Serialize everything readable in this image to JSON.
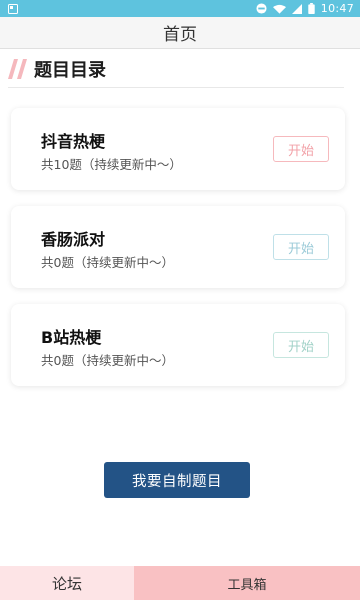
{
  "status_bar": {
    "time": "10:47",
    "left_icon": "notification-icon",
    "right_icons": [
      "dnd-icon",
      "wifi-icon",
      "signal-icon",
      "battery-icon"
    ]
  },
  "header": {
    "title": "首页"
  },
  "section": {
    "title": "题目目录"
  },
  "cards": [
    {
      "title": "抖音热梗",
      "subtitle": "共10题（持续更新中～）",
      "button": "开始"
    },
    {
      "title": "香肠派对",
      "subtitle": "共0题（持续更新中～）",
      "button": "开始"
    },
    {
      "title": "B站热梗",
      "subtitle": "共0题（持续更新中～）",
      "button": "开始"
    }
  ],
  "create_button": "我要自制题目",
  "bottom_nav": {
    "forum": "论坛",
    "tools": "工具箱"
  },
  "colors": {
    "status_bar": "#5ec3de",
    "accent": "#235386",
    "nav_forum": "#fde4e6",
    "nav_tools": "#f9c1c3"
  }
}
